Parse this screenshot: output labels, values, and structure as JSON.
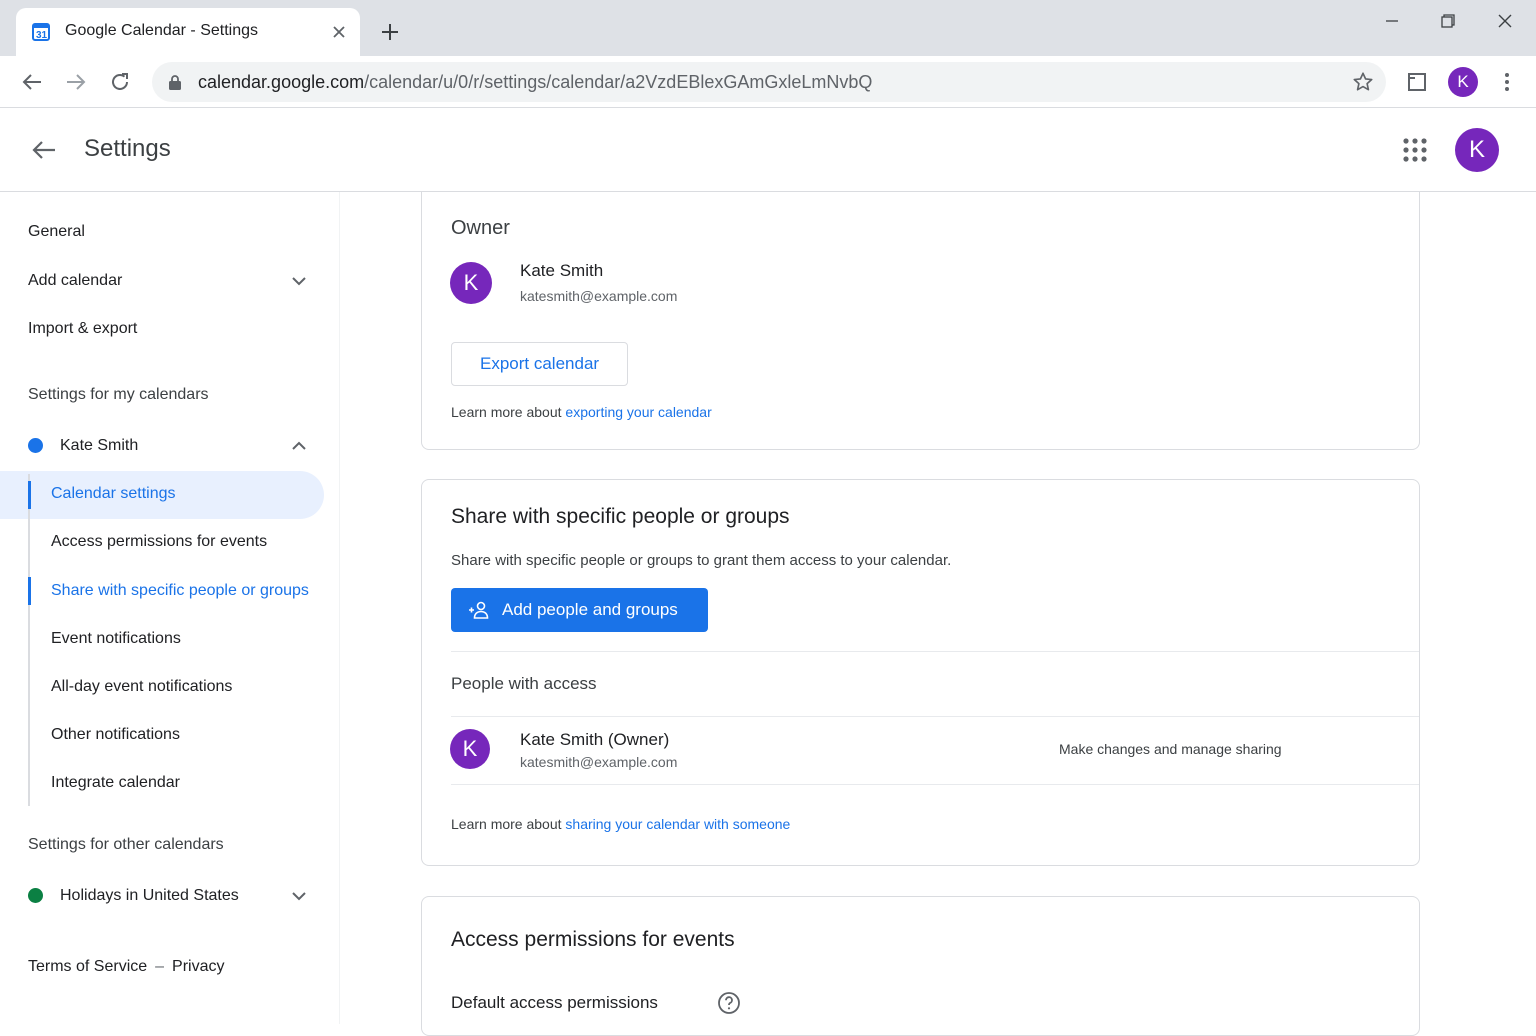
{
  "browser": {
    "tab_title": "Google Calendar - Settings",
    "url_host": "calendar.google.com",
    "url_path": "/calendar/u/0/r/settings/calendar/a2VzdEBlexGAmGxleLmNvbQ",
    "profile_initial": "K"
  },
  "header": {
    "title": "Settings",
    "profile_initial": "K"
  },
  "sidebar": {
    "general": "General",
    "add_calendar": "Add calendar",
    "import_export": "Import & export",
    "my_calendars_heading": "Settings for my calendars",
    "my_calendar": {
      "name": "Kate Smith",
      "color": "#1a73e8"
    },
    "sub_items": [
      "Calendar settings",
      "Access permissions for events",
      "Share with specific people or groups",
      "Event notifications",
      "All-day event notifications",
      "Other notifications",
      "Integrate calendar"
    ],
    "other_calendars_heading": "Settings for other calendars",
    "other_calendar": {
      "name": "Holidays in United States",
      "color": "#0b8043"
    },
    "terms": "Terms of Service",
    "separator": "–",
    "privacy": "Privacy"
  },
  "owner_card": {
    "label": "Owner",
    "avatar_initial": "K",
    "name": "Kate Smith",
    "email": "katesmith@example.com",
    "export_button": "Export calendar",
    "learn_prefix": "Learn more about",
    "learn_link": "exporting your calendar"
  },
  "share_card": {
    "heading": "Share with specific people or groups",
    "description": "Share with specific people or groups to grant them access to your calendar.",
    "add_button": "Add people and groups",
    "people_heading": "People with access",
    "person": {
      "avatar_initial": "K",
      "name": "Kate Smith (Owner)",
      "email": "katesmith@example.com",
      "permission": "Make changes and manage sharing"
    },
    "learn_prefix": "Learn more about",
    "learn_link": "sharing your calendar with someone"
  },
  "access_card": {
    "heading": "Access permissions for events",
    "sub_heading": "Default access permissions"
  },
  "colors": {
    "accent": "#1a73e8",
    "avatar": "#7627bb",
    "active_background": "#e8f0fe"
  }
}
